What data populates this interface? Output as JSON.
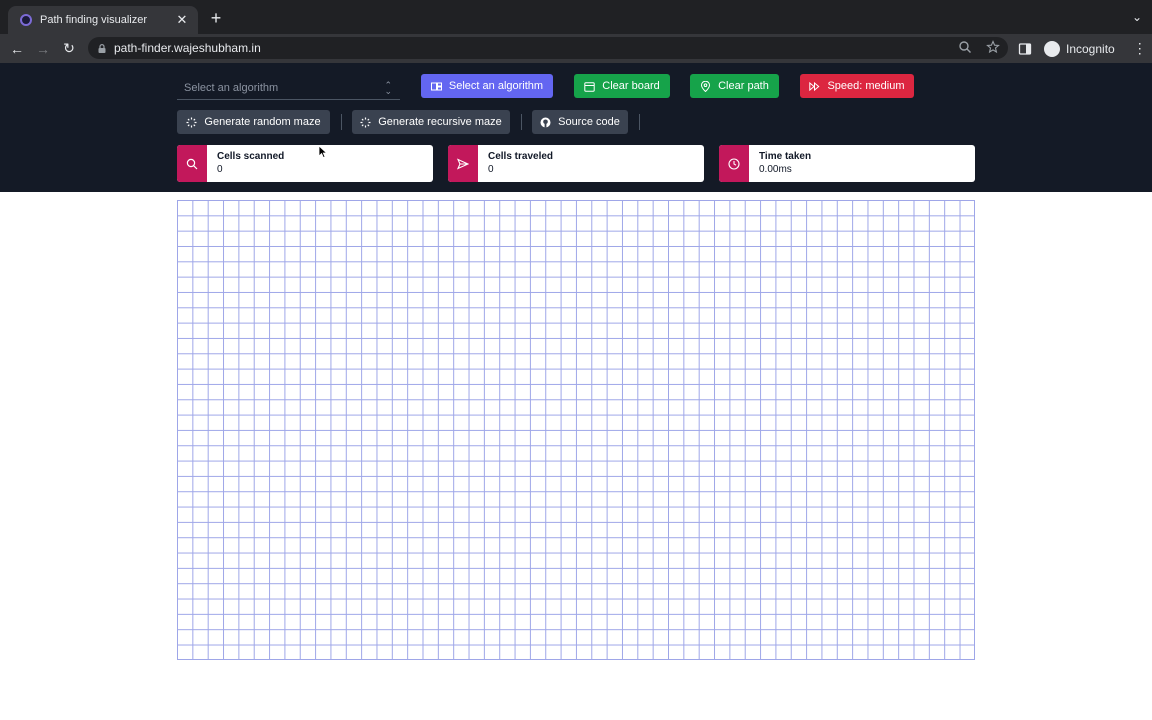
{
  "browser": {
    "tab_title": "Path finding visualizer",
    "url": "path-finder.wajeshubham.in",
    "profile_label": "Incognito"
  },
  "controls": {
    "algorithm_select_placeholder": "Select an algorithm",
    "visualize_button": "Select an algorithm",
    "clear_board_button": "Clear board",
    "clear_path_button": "Clear path",
    "speed_button": "Speed: medium",
    "random_maze_button": "Generate random maze",
    "recursive_maze_button": "Generate recursive maze",
    "source_code_button": "Source code"
  },
  "stats": [
    {
      "label": "Cells scanned",
      "value": "0",
      "icon": "search-icon"
    },
    {
      "label": "Cells traveled",
      "value": "0",
      "icon": "send-icon"
    },
    {
      "label": "Time taken",
      "value": "0.00ms",
      "icon": "clock-icon"
    }
  ],
  "colors": {
    "header_bg": "#141a26",
    "accent_indigo": "#6366f1",
    "accent_green": "#16a34a",
    "accent_red": "#dc2640",
    "stat_icon_bg": "#c2185b",
    "grid_line": "#9ea6e8"
  },
  "grid": {
    "columns": 52,
    "rows": 30
  }
}
